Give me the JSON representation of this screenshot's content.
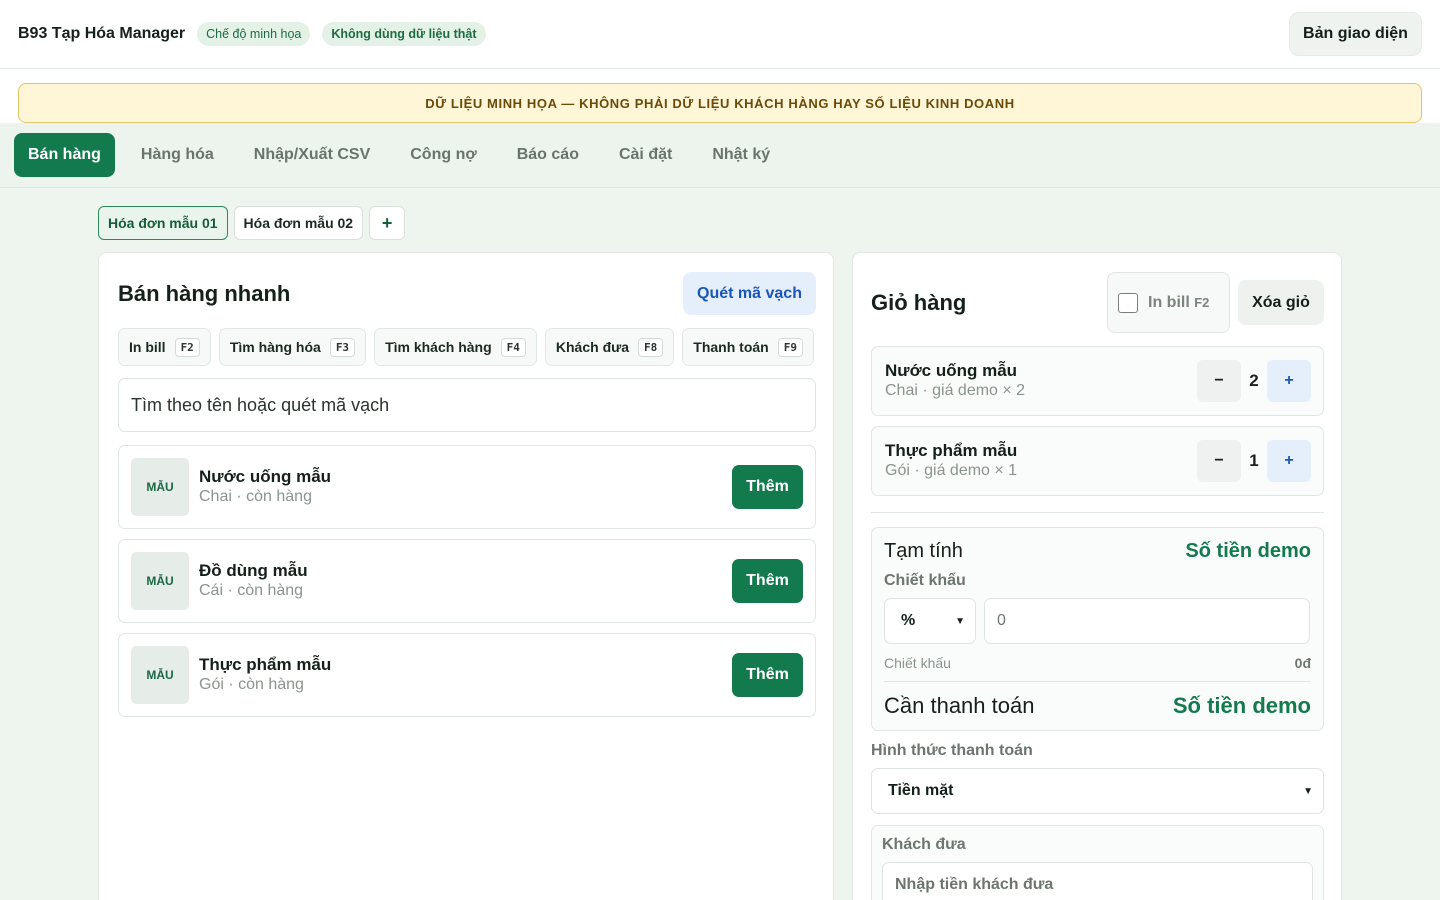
{
  "header": {
    "title": "B93 Tạp Hóa Manager",
    "badge_mode": "Chế độ minh họa",
    "badge_data": "Không dùng dữ liệu thật",
    "theme_button": "Bản giao diện"
  },
  "banner": "DỮ LIỆU MINH HỌA — KHÔNG PHẢI DỮ LIỆU KHÁCH HÀNG HAY SỐ LIỆU KINH DOANH",
  "tabs": [
    {
      "label": "Bán hàng",
      "active": true
    },
    {
      "label": "Hàng hóa"
    },
    {
      "label": "Nhập/Xuất CSV"
    },
    {
      "label": "Công nợ"
    },
    {
      "label": "Báo cáo"
    },
    {
      "label": "Cài đặt"
    },
    {
      "label": "Nhật ký"
    }
  ],
  "invoices": [
    {
      "label": "Hóa đơn mẫu 01",
      "active": true
    },
    {
      "label": "Hóa đơn mẫu 02"
    }
  ],
  "invoice_add": "+",
  "sale": {
    "title": "Bán hàng nhanh",
    "scan_button": "Quét mã vạch",
    "shortcuts": [
      {
        "label": "In bill",
        "key": "F2"
      },
      {
        "label": "Tìm hàng hóa",
        "key": "F3"
      },
      {
        "label": "Tìm khách hàng",
        "key": "F4"
      },
      {
        "label": "Khách đưa",
        "key": "F8"
      },
      {
        "label": "Thanh toán",
        "key": "F9"
      }
    ],
    "search_placeholder": "Tìm theo tên hoặc quét mã vạch",
    "thumb_label": "MẪU",
    "add_label": "Thêm",
    "products": [
      {
        "name": "Nước uống mẫu",
        "sub": "Chai · còn hàng"
      },
      {
        "name": "Đồ dùng mẫu",
        "sub": "Cái · còn hàng"
      },
      {
        "name": "Thực phẩm mẫu",
        "sub": "Gói · còn hàng"
      }
    ]
  },
  "cart": {
    "title": "Giỏ hàng",
    "print_label": "In bill",
    "print_key": "F2",
    "clear_button": "Xóa giỏ",
    "minus": "−",
    "plus": "+",
    "items": [
      {
        "name": "Nước uống mẫu",
        "sub": "Chai · giá demo × 2",
        "qty": "2"
      },
      {
        "name": "Thực phẩm mẫu",
        "sub": "Gói · giá demo × 1",
        "qty": "1"
      }
    ],
    "subtotal_label": "Tạm tính",
    "subtotal_value": "Số tiền demo",
    "discount_label": "Chiết khấu",
    "discount_type": "%",
    "discount_value": "0",
    "discount_row_label": "Chiết khấu",
    "discount_row_value": "0đ",
    "total_label": "Cần thanh toán",
    "total_value": "Số tiền demo",
    "payment_label": "Hình thức thanh toán",
    "payment_method": "Tiền mặt",
    "cash_label": "Khách đưa",
    "cash_placeholder": "Nhập tiền khách đưa"
  }
}
